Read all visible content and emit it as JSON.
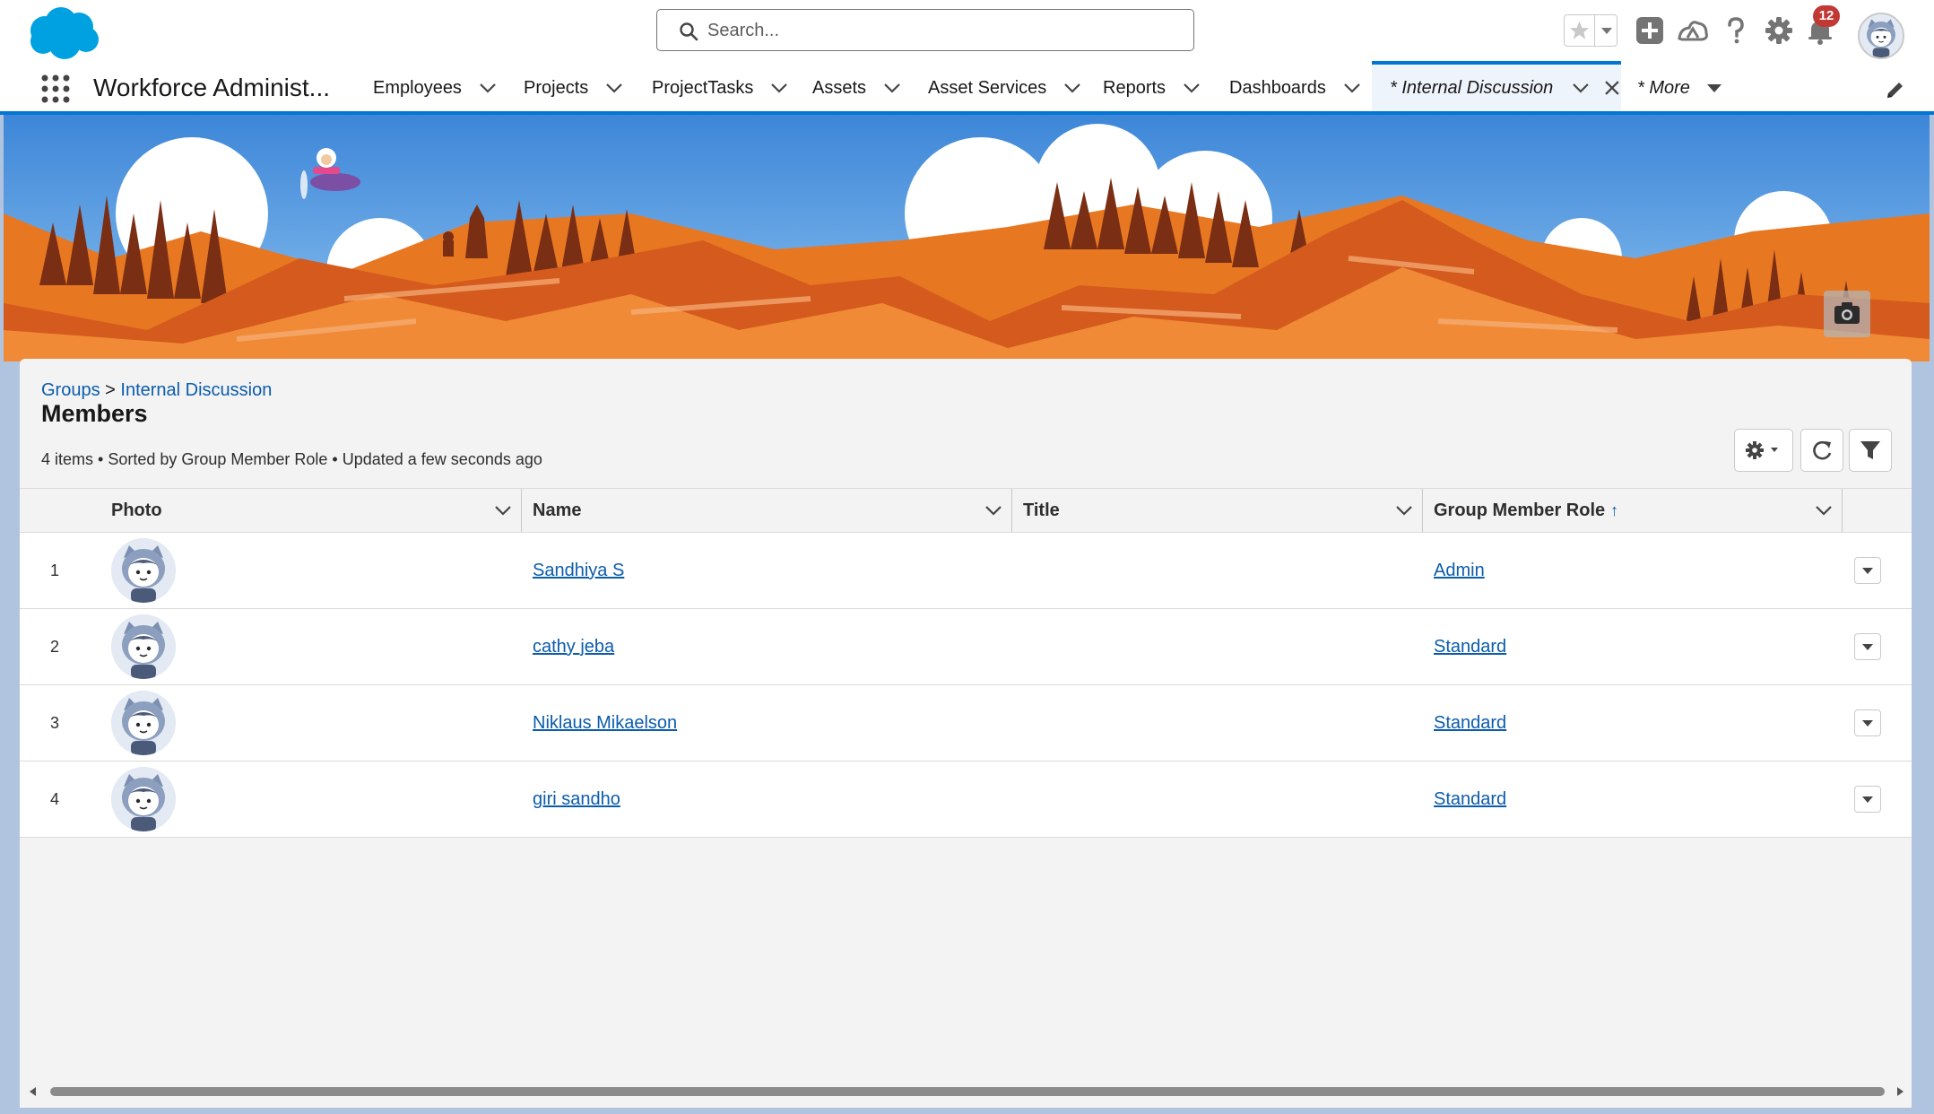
{
  "global_header": {
    "search_placeholder": "Search...",
    "notifications_count": "12",
    "icons": [
      "salesforce-cloud-logo",
      "star-icon",
      "chevron-down-icon",
      "plus-icon",
      "trailhead-icon",
      "help-icon",
      "gear-icon",
      "bell-icon",
      "avatar"
    ]
  },
  "nav": {
    "app_name": "Workforce Administ...",
    "items": [
      {
        "label": "Employees"
      },
      {
        "label": "Projects"
      },
      {
        "label": "ProjectTasks"
      },
      {
        "label": "Assets"
      },
      {
        "label": "Asset Services"
      },
      {
        "label": "Reports"
      },
      {
        "label": "Dashboards"
      }
    ],
    "active_tab": "* Internal Discussion",
    "more_label": "* More"
  },
  "page": {
    "breadcrumb_parent": "Groups",
    "breadcrumb_sep": ">",
    "breadcrumb_current": "Internal Discussion",
    "title": "Members",
    "meta": "4 items • Sorted by Group Member Role • Updated a few seconds ago"
  },
  "table": {
    "columns": {
      "photo": "Photo",
      "name": "Name",
      "title": "Title",
      "role": "Group Member Role",
      "sort_indicator": "↑"
    },
    "rows": [
      {
        "num": "1",
        "name": "Sandhiya S",
        "title": "",
        "role": "Admin"
      },
      {
        "num": "2",
        "name": "cathy jeba",
        "title": "",
        "role": "Standard"
      },
      {
        "num": "3",
        "name": "Niklaus Mikaelson",
        "title": "",
        "role": "Standard"
      },
      {
        "num": "4",
        "name": "giri sandho",
        "title": "",
        "role": "Standard"
      }
    ]
  },
  "colors": {
    "brand_blue": "#0176d3",
    "link_blue": "#0b5cab",
    "badge_red": "#c23934"
  }
}
